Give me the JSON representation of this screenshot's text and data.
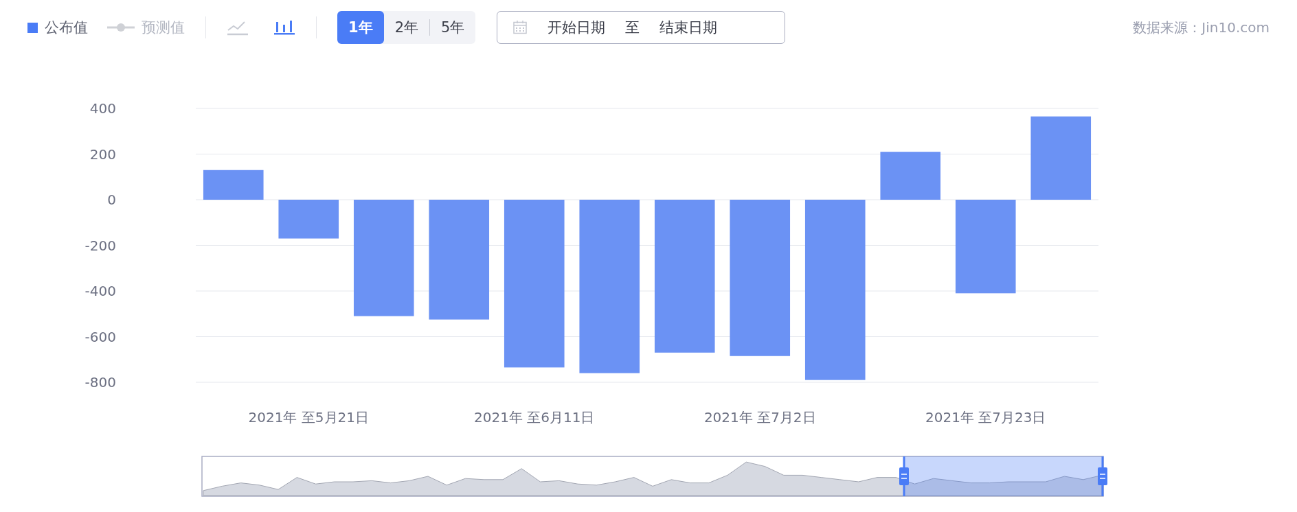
{
  "legend": [
    {
      "label": "公布值",
      "kind": "square",
      "selected": true
    },
    {
      "label": "预测值",
      "kind": "line",
      "selected": false
    }
  ],
  "chart_types": [
    {
      "kind": "line",
      "selected": false
    },
    {
      "kind": "bar",
      "selected": true
    }
  ],
  "range_tabs": [
    {
      "label": "1年",
      "selected": true
    },
    {
      "label": "2年",
      "selected": false
    },
    {
      "label": "5年",
      "selected": false
    }
  ],
  "date_range": {
    "start_placeholder": "开始日期",
    "separator": "至",
    "end_placeholder": "结束日期"
  },
  "source": "数据来源：Jin10.com",
  "chart_data": {
    "type": "bar",
    "values": [
      130,
      -170,
      -510,
      -525,
      -735,
      -760,
      -670,
      -685,
      -790,
      210,
      -410,
      365
    ],
    "categories": [
      null,
      "2021年 至5月21日",
      null,
      null,
      "2021年 至6月11日",
      null,
      null,
      "2021年 至7月2日",
      null,
      null,
      "2021年 至7月23日",
      null
    ],
    "grid": true,
    "ylim": [
      -800,
      400
    ],
    "yticks": [
      {
        "value": 400,
        "label": "400"
      },
      {
        "value": 200,
        "label": "200"
      },
      {
        "value": 0,
        "label": "0"
      },
      {
        "value": -200,
        "label": "-200"
      },
      {
        "value": -400,
        "label": "-400"
      },
      {
        "value": -600,
        "label": "-600"
      },
      {
        "value": -800,
        "label": "-800"
      }
    ]
  }
}
